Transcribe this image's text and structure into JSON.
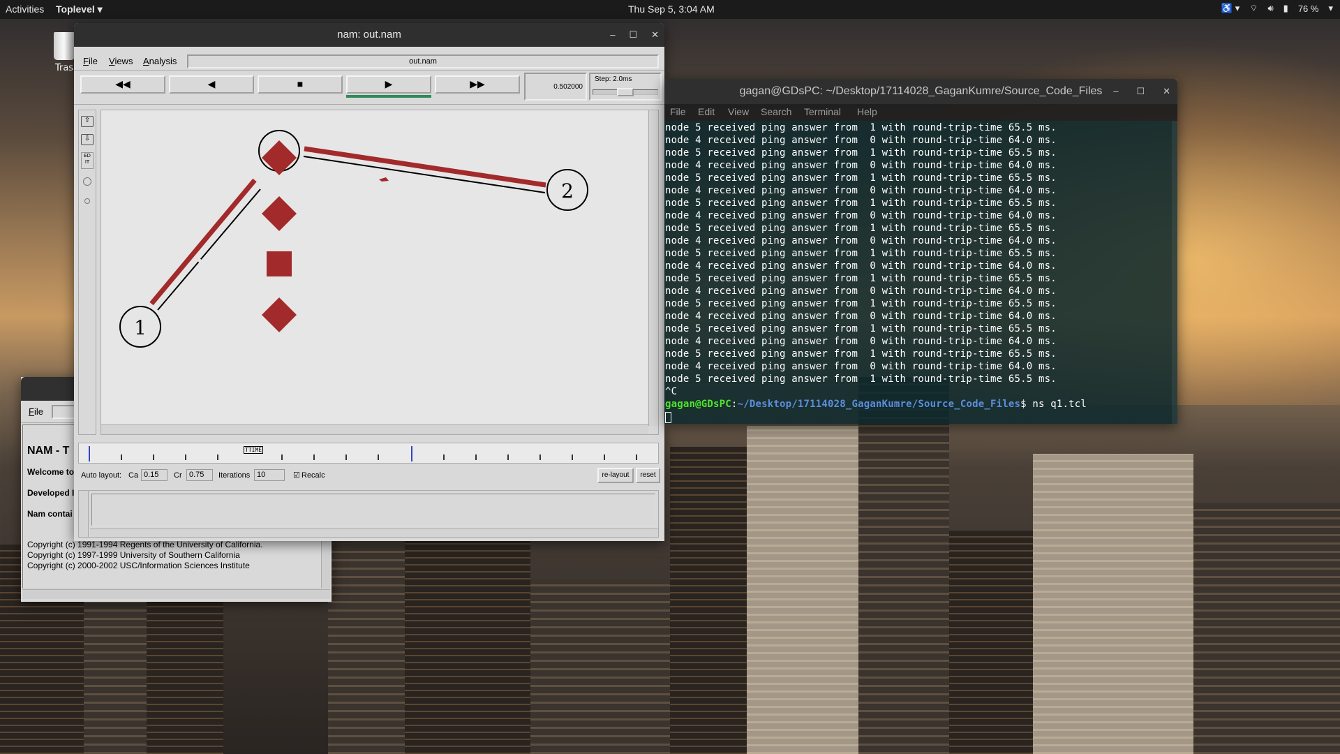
{
  "topbar": {
    "activities": "Activities",
    "toplevel": "Toplevel ▾",
    "clock": "Thu Sep  5,  3:04 AM",
    "battery": "76 %"
  },
  "desktop": {
    "trash_label": "Tras"
  },
  "nam": {
    "title": "nam: out.nam",
    "menu": [
      "File",
      "Views",
      "Analysis"
    ],
    "filename": "out.nam",
    "time_value": "0.502000",
    "step_label": "Step: 2.0ms",
    "edit_icon": "ED IT",
    "nodes": {
      "n1": "1",
      "n2": "2"
    },
    "timeline_marker": "TTIME",
    "autolayout": {
      "label": "Auto layout:",
      "ca_label": "Ca",
      "ca_value": "0.15",
      "cr_label": "Cr",
      "cr_value": "0.75",
      "iter_label": "Iterations",
      "iter_value": "10",
      "recalc_label": "Recalc",
      "relayout_label": "re-layout",
      "reset_label": "reset"
    }
  },
  "about": {
    "menu_file": "File",
    "heading": "NAM - T",
    "welcome": "Welcome to",
    "developed": "Developed I",
    "contains": "Nam contai",
    "copyright1": "Copyright (c) 1991-1994 Regents of the University of California.",
    "copyright2": "Copyright (c) 1997-1999 University of Southern California",
    "copyright3": "Copyright (c) 2000-2002 USC/Information Sciences Institute"
  },
  "terminal": {
    "title": "gagan@GDsPC: ~/Desktop/17114028_GaganKumre/Source_Code_Files",
    "menu": [
      "File",
      "Edit",
      "View",
      "Search",
      "Terminal",
      "Help"
    ],
    "lines": [
      "node 5 received ping answer from  1 with round-trip-time 65.5 ms.",
      "node 4 received ping answer from  0 with round-trip-time 64.0 ms.",
      "node 5 received ping answer from  1 with round-trip-time 65.5 ms.",
      "node 4 received ping answer from  0 with round-trip-time 64.0 ms.",
      "node 5 received ping answer from  1 with round-trip-time 65.5 ms.",
      "node 4 received ping answer from  0 with round-trip-time 64.0 ms.",
      "node 5 received ping answer from  1 with round-trip-time 65.5 ms.",
      "node 4 received ping answer from  0 with round-trip-time 64.0 ms.",
      "node 5 received ping answer from  1 with round-trip-time 65.5 ms.",
      "node 4 received ping answer from  0 with round-trip-time 64.0 ms.",
      "node 5 received ping answer from  1 with round-trip-time 65.5 ms.",
      "node 4 received ping answer from  0 with round-trip-time 64.0 ms.",
      "node 5 received ping answer from  1 with round-trip-time 65.5 ms.",
      "node 4 received ping answer from  0 with round-trip-time 64.0 ms.",
      "node 5 received ping answer from  1 with round-trip-time 65.5 ms.",
      "node 4 received ping answer from  0 with round-trip-time 64.0 ms.",
      "node 5 received ping answer from  1 with round-trip-time 65.5 ms.",
      "node 4 received ping answer from  0 with round-trip-time 64.0 ms.",
      "node 5 received ping answer from  1 with round-trip-time 65.5 ms.",
      "node 4 received ping answer from  0 with round-trip-time 64.0 ms.",
      "node 5 received ping answer from  1 with round-trip-time 65.5 ms.",
      "^C"
    ],
    "prompt_user": "gagan@GDsPC",
    "prompt_sep": ":",
    "prompt_path": "~/Desktop/17114028_GaganKumre/Source_Code_Files",
    "prompt_cmd": "$ ns q1.tcl"
  },
  "colors": {
    "packet": "#a32a2a",
    "terminal_bg": "#0c282c",
    "prompt_green": "#4fe62a",
    "prompt_blue": "#5b8fdc"
  }
}
